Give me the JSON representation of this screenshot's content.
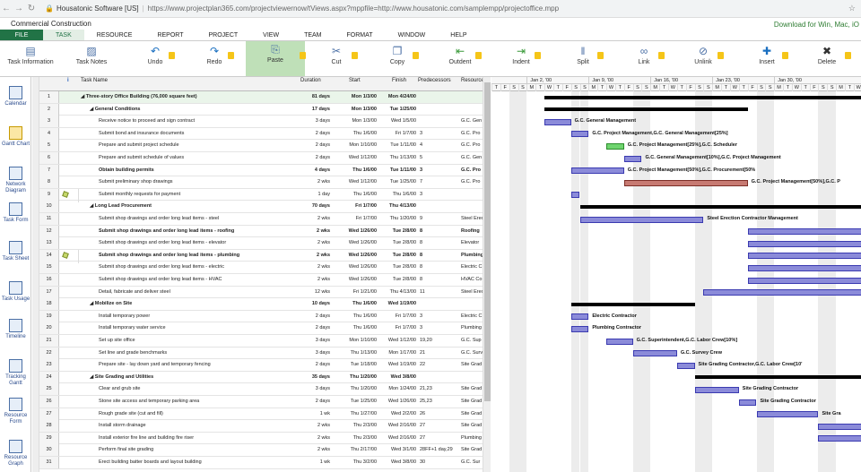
{
  "browser": {
    "site": "Housatonic Software [US]",
    "url": "https://www.projectplan365.com/projectviewernow/tViews.aspx?mppfile=http://www.housatonic.com/samplempp/projectoffice.mpp"
  },
  "app": {
    "title": "Commercial Construction",
    "promo": "Download for Win, Mac, iO"
  },
  "menu": [
    "FILE",
    "TASK",
    "RESOURCE",
    "REPORT",
    "PROJECT",
    "VIEW",
    "TEAM",
    "FORMAT",
    "WINDOW",
    "HELP"
  ],
  "ribbon": [
    {
      "label": "Task Information",
      "icon": "task-information-icon"
    },
    {
      "label": "Task Notes",
      "icon": "task-notes-icon"
    },
    {
      "label": "Undo",
      "icon": "undo-icon"
    },
    {
      "label": "Redo",
      "icon": "redo-icon"
    },
    {
      "label": "Paste",
      "icon": "paste-icon"
    },
    {
      "label": "Cut",
      "icon": "cut-icon"
    },
    {
      "label": "Copy",
      "icon": "copy-icon"
    },
    {
      "label": "Outdent",
      "icon": "outdent-icon"
    },
    {
      "label": "Indent",
      "icon": "indent-icon"
    },
    {
      "label": "Split",
      "icon": "split-icon"
    },
    {
      "label": "Link",
      "icon": "link-icon"
    },
    {
      "label": "Unlink",
      "icon": "unlink-icon"
    },
    {
      "label": "Insert",
      "icon": "insert-icon"
    },
    {
      "label": "Delete",
      "icon": "delete-icon"
    }
  ],
  "views": [
    {
      "label": "Calendar",
      "icon": "calendar-icon"
    },
    {
      "label": "Gantt Chart",
      "icon": "gantt-chart-icon"
    },
    {
      "label": "Network Diagram",
      "icon": "network-diagram-icon"
    },
    {
      "label": "Task Form",
      "icon": "task-form-icon"
    },
    {
      "label": "Task Sheet",
      "icon": "task-sheet-icon"
    },
    {
      "label": "Task Usage",
      "icon": "task-usage-icon"
    },
    {
      "label": "Timeline",
      "icon": "timeline-icon"
    },
    {
      "label": "Tracking Gantt",
      "icon": "tracking-gantt-icon"
    },
    {
      "label": "Resource Form",
      "icon": "resource-form-icon"
    },
    {
      "label": "Resource Graph",
      "icon": "resource-graph-icon"
    }
  ],
  "columns": {
    "name": "Task Name",
    "duration": "Duration",
    "start": "Start",
    "finish": "Finish",
    "pred": "Predecessors",
    "res": "Resource",
    "info": "i"
  },
  "tasks": [
    {
      "id": "1",
      "name": "Three-story Office Building (76,000 square feet)",
      "dur": "81 days",
      "start": "Mon 1/3/00",
      "finish": "Mon 4/24/00",
      "pred": "",
      "res": "",
      "lvl": 0,
      "sum": true,
      "note": false
    },
    {
      "id": "2",
      "name": "General Conditions",
      "dur": "17 days",
      "start": "Mon 1/3/00",
      "finish": "Tue 1/25/00",
      "pred": "",
      "res": "",
      "lvl": 1,
      "sum": true,
      "note": false
    },
    {
      "id": "3",
      "name": "Receive notice to proceed and sign contract",
      "dur": "3 days",
      "start": "Mon 1/3/00",
      "finish": "Wed 1/5/00",
      "pred": "",
      "res": "G.C. Gen",
      "lvl": 2,
      "sum": false,
      "note": false
    },
    {
      "id": "4",
      "name": "Submit bond and insurance documents",
      "dur": "2 days",
      "start": "Thu 1/6/00",
      "finish": "Fri 1/7/00",
      "pred": "3",
      "res": "G.C. Pro",
      "lvl": 2,
      "sum": false,
      "note": false
    },
    {
      "id": "5",
      "name": "Prepare and submit project schedule",
      "dur": "2 days",
      "start": "Mon 1/10/00",
      "finish": "Tue 1/11/00",
      "pred": "4",
      "res": "G.C. Pro",
      "lvl": 2,
      "sum": false,
      "note": false
    },
    {
      "id": "6",
      "name": "Prepare and submit schedule of values",
      "dur": "2 days",
      "start": "Wed 1/12/00",
      "finish": "Thu 1/13/00",
      "pred": "5",
      "res": "G.C. Gen",
      "lvl": 2,
      "sum": false,
      "note": false
    },
    {
      "id": "7",
      "name": "Obtain building permits",
      "dur": "4 days",
      "start": "Thu 1/6/00",
      "finish": "Tue 1/11/00",
      "pred": "3",
      "res": "G.C. Pro",
      "lvl": 2,
      "sum": true,
      "note": false
    },
    {
      "id": "8",
      "name": "Submit preliminary shop drawings",
      "dur": "2 wks",
      "start": "Wed 1/12/00",
      "finish": "Tue 1/25/00",
      "pred": "7",
      "res": "G.C. Pro",
      "lvl": 2,
      "sum": false,
      "note": false
    },
    {
      "id": "9",
      "name": "Submit monthly requests for payment",
      "dur": "1 day",
      "start": "Thu 1/6/00",
      "finish": "Thu 1/6/00",
      "pred": "3",
      "res": "",
      "lvl": 2,
      "sum": false,
      "note": true
    },
    {
      "id": "10",
      "name": "Long Lead Procurement",
      "dur": "70 days",
      "start": "Fri 1/7/00",
      "finish": "Thu 4/13/00",
      "pred": "",
      "res": "",
      "lvl": 1,
      "sum": true,
      "note": false
    },
    {
      "id": "11",
      "name": "Submit shop drawings and order long lead items - steel",
      "dur": "2 wks",
      "start": "Fri 1/7/00",
      "finish": "Thu 1/20/00",
      "pred": "9",
      "res": "Steel Erec",
      "lvl": 2,
      "sum": false,
      "note": false
    },
    {
      "id": "12",
      "name": "Submit shop drawings and order long lead items - roofing",
      "dur": "2 wks",
      "start": "Wed 1/26/00",
      "finish": "Tue 2/8/00",
      "pred": "8",
      "res": "Roofing",
      "lvl": 2,
      "sum": true,
      "note": false
    },
    {
      "id": "13",
      "name": "Submit shop drawings and order long lead items - elevator",
      "dur": "2 wks",
      "start": "Wed 1/26/00",
      "finish": "Tue 2/8/00",
      "pred": "8",
      "res": "Elevator",
      "lvl": 2,
      "sum": false,
      "note": false
    },
    {
      "id": "14",
      "name": "Submit shop drawings and order long lead items - plumbing",
      "dur": "2 wks",
      "start": "Wed 1/26/00",
      "finish": "Tue 2/8/00",
      "pred": "8",
      "res": "Plumbing",
      "lvl": 2,
      "sum": true,
      "note": true
    },
    {
      "id": "15",
      "name": "Submit shop drawings and order long lead items - electric",
      "dur": "2 wks",
      "start": "Wed 1/26/00",
      "finish": "Tue 2/8/00",
      "pred": "8",
      "res": "Electric C",
      "lvl": 2,
      "sum": false,
      "note": false
    },
    {
      "id": "16",
      "name": "Submit shop drawings and order long lead items - HVAC",
      "dur": "2 wks",
      "start": "Wed 1/26/00",
      "finish": "Tue 2/8/00",
      "pred": "8",
      "res": "HVAC Co",
      "lvl": 2,
      "sum": false,
      "note": false
    },
    {
      "id": "17",
      "name": "Detail, fabricate and deliver steel",
      "dur": "12 wks",
      "start": "Fri 1/21/00",
      "finish": "Thu 4/13/00",
      "pred": "11",
      "res": "Steel Erec",
      "lvl": 2,
      "sum": false,
      "note": false
    },
    {
      "id": "18",
      "name": "Mobilize on Site",
      "dur": "10 days",
      "start": "Thu 1/6/00",
      "finish": "Wed 1/19/00",
      "pred": "",
      "res": "",
      "lvl": 1,
      "sum": true,
      "note": false
    },
    {
      "id": "19",
      "name": "Install temporary power",
      "dur": "2 days",
      "start": "Thu 1/6/00",
      "finish": "Fri 1/7/00",
      "pred": "3",
      "res": "Electric C",
      "lvl": 2,
      "sum": false,
      "note": false
    },
    {
      "id": "20",
      "name": "Install temporary water service",
      "dur": "2 days",
      "start": "Thu 1/6/00",
      "finish": "Fri 1/7/00",
      "pred": "3",
      "res": "Plumbing",
      "lvl": 2,
      "sum": false,
      "note": false
    },
    {
      "id": "21",
      "name": "Set up site office",
      "dur": "3 days",
      "start": "Mon 1/10/00",
      "finish": "Wed 1/12/00",
      "pred": "19,20",
      "res": "G.C. Sup",
      "lvl": 2,
      "sum": false,
      "note": false
    },
    {
      "id": "22",
      "name": "Set line and grade benchmarks",
      "dur": "3 days",
      "start": "Thu 1/13/00",
      "finish": "Mon 1/17/00",
      "pred": "21",
      "res": "G.C. Surv",
      "lvl": 2,
      "sum": false,
      "note": false
    },
    {
      "id": "23",
      "name": "Prepare site - lay down yard and temporary fencing",
      "dur": "2 days",
      "start": "Tue 1/18/00",
      "finish": "Wed 1/19/00",
      "pred": "22",
      "res": "Site Grad",
      "lvl": 2,
      "sum": false,
      "note": false
    },
    {
      "id": "24",
      "name": "Site Grading and Utilities",
      "dur": "35 days",
      "start": "Thu 1/20/00",
      "finish": "Wed 3/8/00",
      "pred": "",
      "res": "",
      "lvl": 1,
      "sum": true,
      "note": false
    },
    {
      "id": "25",
      "name": "Clear and grub site",
      "dur": "3 days",
      "start": "Thu 1/20/00",
      "finish": "Mon 1/24/00",
      "pred": "21,23",
      "res": "Site Grad",
      "lvl": 2,
      "sum": false,
      "note": false
    },
    {
      "id": "26",
      "name": "Stone site access and temporary parking area",
      "dur": "2 days",
      "start": "Tue 1/25/00",
      "finish": "Wed 1/26/00",
      "pred": "25,23",
      "res": "Site Grad",
      "lvl": 2,
      "sum": false,
      "note": false
    },
    {
      "id": "27",
      "name": "Rough grade site (cut and fill)",
      "dur": "1 wk",
      "start": "Thu 1/27/00",
      "finish": "Wed 2/2/00",
      "pred": "26",
      "res": "Site Grad",
      "lvl": 2,
      "sum": false,
      "note": false
    },
    {
      "id": "28",
      "name": "Install storm drainage",
      "dur": "2 wks",
      "start": "Thu 2/3/00",
      "finish": "Wed 2/16/00",
      "pred": "27",
      "res": "Site Grad",
      "lvl": 2,
      "sum": false,
      "note": false
    },
    {
      "id": "29",
      "name": "Install exterior fire line and building fire riser",
      "dur": "2 wks",
      "start": "Thu 2/3/00",
      "finish": "Wed 2/16/00",
      "pred": "27",
      "res": "Plumbing",
      "lvl": 2,
      "sum": false,
      "note": false
    },
    {
      "id": "30",
      "name": "Perform final site grading",
      "dur": "2 wks",
      "start": "Thu 2/17/00",
      "finish": "Wed 3/1/00",
      "pred": "28FF+1 day,29",
      "res": "Site Grad",
      "lvl": 2,
      "sum": false,
      "note": false
    },
    {
      "id": "31",
      "name": "Erect building batter boards and layout building",
      "dur": "1 wk",
      "start": "Thu 3/2/00",
      "finish": "Wed 3/8/00",
      "pred": "30",
      "res": "G.C. Sur",
      "lvl": 2,
      "sum": false,
      "note": false
    }
  ],
  "timescale": {
    "weeks": [
      "Jan 2, '00",
      "Jan 9, '00",
      "Jan 16, '00",
      "Jan 23, '00",
      "Jan 30, '00"
    ],
    "days": [
      "T",
      "F",
      "S",
      "S",
      "M",
      "T",
      "W",
      "T",
      "F",
      "S",
      "S",
      "M",
      "T",
      "W",
      "T",
      "F",
      "S",
      "S",
      "M",
      "T",
      "W",
      "T",
      "F",
      "S",
      "S",
      "M",
      "T",
      "W",
      "T",
      "F",
      "S",
      "S",
      "M",
      "T",
      "W",
      "T",
      "F",
      "S",
      "S",
      "M",
      "T",
      "W"
    ]
  },
  "bar_labels": [
    "G.C. General Management",
    "G.C. Project Management,G.C. General Management[25%]",
    "G.C. Project Management[25%],G.C. Scheduler",
    "G.C. General Management[10%],G.C. Project Management",
    "G.C. Project Management[50%],G.C. Procurement[50%",
    "G.C. Project Management[50%],G.C. P",
    "Steel Erection Contractor Management",
    "Electric Contractor",
    "Plumbing Contractor",
    "G.C. Superintendent,G.C. Labor Crew[10%]",
    "G.C. Survey Crew",
    "Site Grading Contractor,G.C. Labor Crew[10'",
    "Site Grading Contractor",
    "Site Grading Contractor",
    "Site Gra"
  ]
}
